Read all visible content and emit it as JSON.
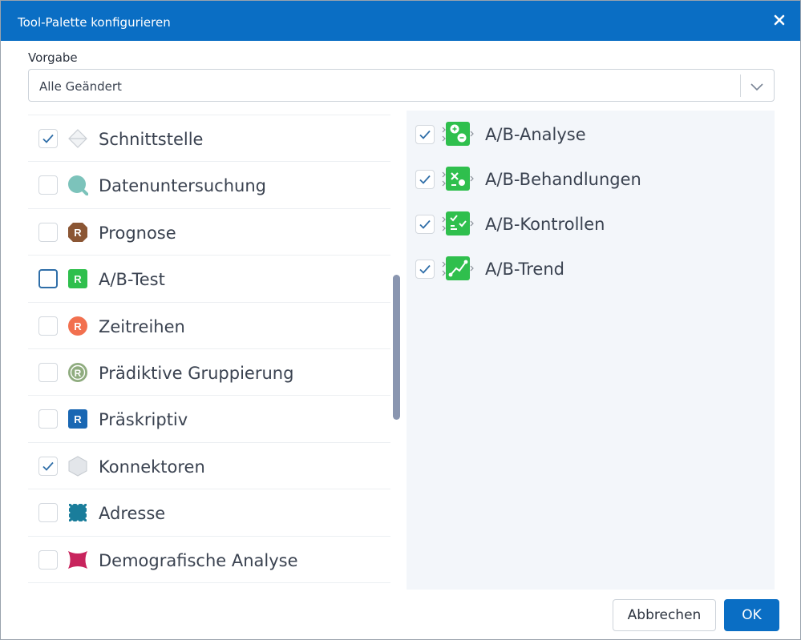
{
  "dialog": {
    "title": "Tool-Palette konfigurieren",
    "accent_color": "#0a6ec4"
  },
  "preset": {
    "label": "Vorgabe",
    "value": "Alle Geändert"
  },
  "categories": [
    {
      "label": "Schnittstelle",
      "checked": true,
      "icon": "interface-diamond-icon"
    },
    {
      "label": "Datenuntersuchung",
      "checked": false,
      "icon": "data-investigation-icon"
    },
    {
      "label": "Prognose",
      "checked": false,
      "icon": "r-prognose-icon"
    },
    {
      "label": "A/B-Test",
      "checked": false,
      "focused": true,
      "icon": "r-ab-test-icon"
    },
    {
      "label": "Zeitreihen",
      "checked": false,
      "icon": "r-time-series-icon"
    },
    {
      "label": "Prädiktive Gruppierung",
      "checked": false,
      "icon": "r-grouping-icon"
    },
    {
      "label": "Präskriptiv",
      "checked": false,
      "icon": "r-prescriptive-icon"
    },
    {
      "label": "Konnektoren",
      "checked": true,
      "icon": "connector-hexagon-icon"
    },
    {
      "label": "Adresse",
      "checked": false,
      "icon": "address-stamp-icon"
    },
    {
      "label": "Demografische Analyse",
      "checked": false,
      "icon": "demographic-icon"
    }
  ],
  "tools": [
    {
      "label": "A/B-Analyse",
      "checked": true,
      "icon": "ab-analysis-icon"
    },
    {
      "label": "A/B-Behandlungen",
      "checked": true,
      "icon": "ab-treatments-icon"
    },
    {
      "label": "A/B-Kontrollen",
      "checked": true,
      "icon": "ab-controls-icon"
    },
    {
      "label": "A/B-Trend",
      "checked": true,
      "icon": "ab-trend-icon"
    }
  ],
  "buttons": {
    "cancel": "Abbrechen",
    "ok": "OK"
  }
}
